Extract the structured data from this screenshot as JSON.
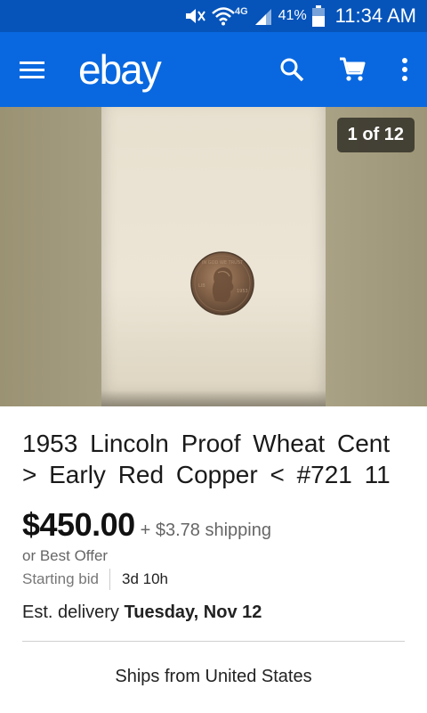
{
  "status_bar": {
    "network": "4G",
    "battery": "41%",
    "time": "11:34 AM"
  },
  "app_bar": {
    "logo": "ebay",
    "icons": [
      "menu-icon",
      "search-icon",
      "cart-icon",
      "more-vert-icon"
    ]
  },
  "gallery": {
    "counter": "1 of 12"
  },
  "listing": {
    "title": "1953 Lincoln Proof Wheat Cent > Early Red Copper < #721 11",
    "price": "$450.00",
    "shipping": "+ $3.78 shipping",
    "offer": "or Best Offer",
    "bid_label": "Starting bid",
    "time_left": "3d 10h",
    "delivery_label": "Est. delivery",
    "delivery_date": "Tuesday, Nov 12",
    "ships_from": "Ships from United States"
  },
  "colors": {
    "status_bar": "#0654ba",
    "app_bar": "#0968e0"
  }
}
